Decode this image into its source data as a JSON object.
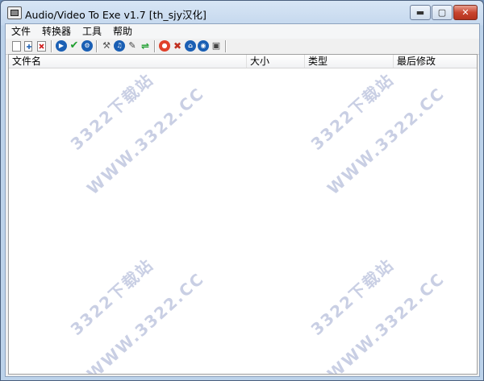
{
  "window": {
    "title": "Audio/Video To Exe v1.7 [th_sjy汉化]",
    "controls": {
      "minimize": "▬",
      "maximize": "▢",
      "close": "✕"
    }
  },
  "menu": [
    "文件",
    "转换器",
    "工具",
    "帮助"
  ],
  "toolbar": [
    {
      "icon": "new-file-icon"
    },
    {
      "icon": "add-file-icon"
    },
    {
      "icon": "delete-icon",
      "color": "#d02020"
    },
    {
      "icon": "play-icon",
      "color": "#1a5fb4"
    },
    {
      "icon": "check-icon",
      "color": "#1e9e2e"
    },
    {
      "icon": "settings-circle-icon",
      "color": "#1a5fb4"
    },
    {
      "icon": "tools-icon"
    },
    {
      "icon": "music-icon",
      "color": "#1a5fb4"
    },
    {
      "icon": "script-icon"
    },
    {
      "icon": "split-arrow-icon",
      "color": "#1e9e2e"
    },
    {
      "icon": "lifebuoy-icon",
      "color": "#e0402a"
    },
    {
      "icon": "wrench-icon"
    },
    {
      "icon": "home-icon",
      "color": "#1a5fb4"
    },
    {
      "icon": "globe-icon",
      "color": "#1a5fb4"
    },
    {
      "icon": "about-icon"
    }
  ],
  "columns": [
    "文件名",
    "大小",
    "类型",
    "最后修改"
  ],
  "rows": [],
  "watermark": {
    "cn": "3322下载站",
    "url": "WWW.3322.CC"
  }
}
